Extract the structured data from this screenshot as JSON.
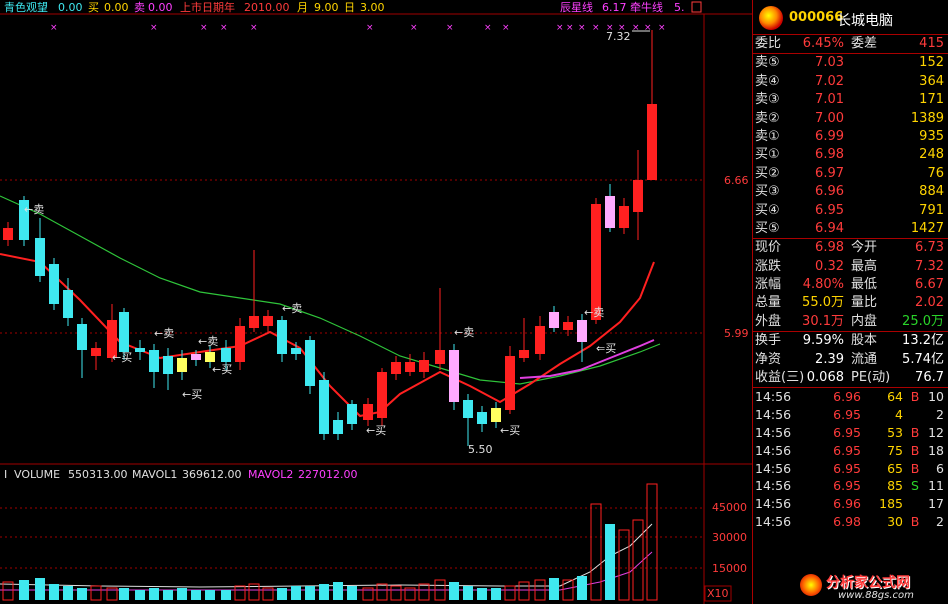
{
  "header": {
    "title": "青色观望",
    "title_val": "0.00",
    "buy_label": "买",
    "buy_val": "0.00",
    "sell_label": "卖",
    "sell_val": "0.00",
    "ipo_label": "上市日期年",
    "ipo_val": "2010.00",
    "month_label": "月",
    "month_val": "9.00",
    "day_label": "日",
    "day_val": "3.00",
    "star_label": "辰星线",
    "star_val": "6.17",
    "cow_label": "牵牛线",
    "cow_val": "5."
  },
  "price_axis": [
    "6.66",
    "5.99"
  ],
  "annotations": {
    "high": "7.32",
    "low": "5.50",
    "sell": "←卖",
    "buy": "←买",
    "buy_alt": "⇐买"
  },
  "volume_header": {
    "volume_label": "VOLUME",
    "volume_val": "550313.00",
    "mavol1_label": "MAVOL1",
    "mavol1_val": "369612.00",
    "mavol2_label": "MAVOL2",
    "mavol2_val": "227012.00"
  },
  "volume_axis": [
    "45000",
    "30000",
    "15000"
  ],
  "volume_unit": "X10",
  "colors": {
    "up": "#ff2020",
    "down": "#3fe8f0",
    "ma_short": "#ff2020",
    "ma_long": "#2fc43a",
    "ma_mid": "#e040e0",
    "grid": "#a00000",
    "label": "#ff3b3b"
  },
  "chart_data": {
    "type": "candlestick",
    "price_ticks": [
      6.66,
      5.99
    ],
    "high": 7.32,
    "low": 5.5,
    "volume_ticks": [
      45000,
      30000,
      15000
    ]
  },
  "quote": {
    "code": "000066",
    "name": "长城电脑",
    "rows": [
      {
        "l": "委比",
        "v": "6.45%",
        "c": "red",
        "l2": "委差",
        "v2": "415",
        "c2": "red"
      },
      {
        "l": "卖⑤",
        "v": "7.03",
        "c": "red",
        "v2": "152",
        "c2": "yellow"
      },
      {
        "l": "卖④",
        "v": "7.02",
        "c": "red",
        "v2": "364",
        "c2": "yellow"
      },
      {
        "l": "卖③",
        "v": "7.01",
        "c": "red",
        "v2": "171",
        "c2": "yellow"
      },
      {
        "l": "卖②",
        "v": "7.00",
        "c": "red",
        "v2": "1389",
        "c2": "yellow"
      },
      {
        "l": "卖①",
        "v": "6.99",
        "c": "red",
        "v2": "935",
        "c2": "yellow"
      },
      {
        "l": "买①",
        "v": "6.98",
        "c": "red",
        "v2": "248",
        "c2": "yellow"
      },
      {
        "l": "买②",
        "v": "6.97",
        "c": "red",
        "v2": "76",
        "c2": "yellow"
      },
      {
        "l": "买③",
        "v": "6.96",
        "c": "red",
        "v2": "884",
        "c2": "yellow"
      },
      {
        "l": "买④",
        "v": "6.95",
        "c": "red",
        "v2": "791",
        "c2": "yellow"
      },
      {
        "l": "买⑤",
        "v": "6.94",
        "c": "red",
        "v2": "1427",
        "c2": "yellow"
      },
      {
        "l": "现价",
        "v": "6.98",
        "c": "red",
        "l2": "今开",
        "v2": "6.73",
        "c2": "red"
      },
      {
        "l": "涨跌",
        "v": "0.32",
        "c": "red",
        "l2": "最高",
        "v2": "7.32",
        "c2": "red"
      },
      {
        "l": "涨幅",
        "v": "4.80%",
        "c": "red",
        "l2": "最低",
        "v2": "6.67",
        "c2": "red"
      },
      {
        "l": "总量",
        "v": "55.0万",
        "c": "yellow",
        "l2": "量比",
        "v2": "2.02",
        "c2": "red"
      },
      {
        "l": "外盘",
        "v": "30.1万",
        "c": "red",
        "l2": "内盘",
        "v2": "25.0万",
        "c2": "green"
      },
      {
        "l": "换手",
        "v": "9.59%",
        "c": "white",
        "l2": "股本",
        "v2": "13.2亿",
        "c2": "white"
      },
      {
        "l": "净资",
        "v": "2.39",
        "c": "white",
        "l2": "流通",
        "v2": "5.74亿",
        "c2": "white"
      },
      {
        "l": "收益(三)",
        "v": "0.068",
        "c": "white",
        "l2": "PE(动)",
        "v2": "76.7",
        "c2": "white"
      }
    ],
    "trades": [
      {
        "t": "14:56",
        "p": "6.96",
        "v": "64",
        "bs": "B",
        "n": "10"
      },
      {
        "t": "14:56",
        "p": "6.95",
        "v": "4",
        "bs": "",
        "n": "2"
      },
      {
        "t": "14:56",
        "p": "6.95",
        "v": "53",
        "bs": "B",
        "n": "12"
      },
      {
        "t": "14:56",
        "p": "6.95",
        "v": "75",
        "bs": "B",
        "n": "18"
      },
      {
        "t": "14:56",
        "p": "6.95",
        "v": "65",
        "bs": "B",
        "n": "6"
      },
      {
        "t": "14:56",
        "p": "6.95",
        "v": "85",
        "bs": "S",
        "n": "11"
      },
      {
        "t": "14:56",
        "p": "6.96",
        "v": "185",
        "bs": "",
        "n": "17"
      },
      {
        "t": "14:56",
        "p": "6.98",
        "v": "30",
        "bs": "B",
        "n": "2"
      }
    ]
  },
  "watermark": {
    "cn": "分析家公式网",
    "url": "www.88gs.com"
  }
}
